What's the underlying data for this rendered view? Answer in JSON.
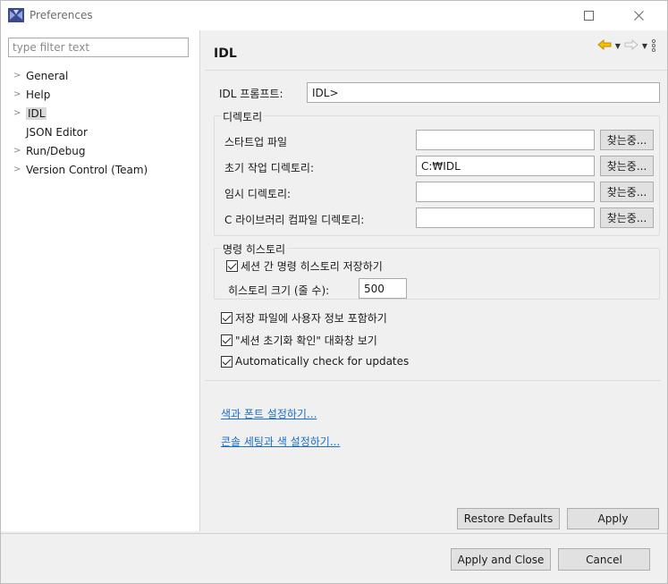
{
  "window": {
    "title": "Preferences",
    "icons": {
      "app": "eclipse-app-icon",
      "maximize": "maximize-icon",
      "close": "close-icon"
    }
  },
  "sidebar": {
    "filter_placeholder": "type filter text",
    "items": [
      {
        "label": "General",
        "expandable": true,
        "selected": false
      },
      {
        "label": "Help",
        "expandable": true,
        "selected": false
      },
      {
        "label": "IDL",
        "expandable": true,
        "selected": true
      },
      {
        "label": "JSON Editor",
        "expandable": false,
        "selected": false
      },
      {
        "label": "Run/Debug",
        "expandable": true,
        "selected": false
      },
      {
        "label": "Version Control (Team)",
        "expandable": true,
        "selected": false
      }
    ]
  },
  "page": {
    "title": "IDL",
    "toolbar_icons": [
      "back-arrow-icon",
      "forward-arrow-icon",
      "view-menu-icon"
    ],
    "prompt": {
      "label": "IDL 프롬프트:",
      "value": "IDL>"
    },
    "directory_group": {
      "title": "디렉토리",
      "rows": [
        {
          "label": "스타트업 파일",
          "value": "",
          "button": "찾는중..."
        },
        {
          "label": "초기 작업 디렉토리:",
          "value": "C:₩IDL",
          "button": "찾는중..."
        },
        {
          "label": "임시 디렉토리:",
          "value": "",
          "button": "찾는중..."
        },
        {
          "label": "C 라이브러리 컴파일 디렉토리:",
          "value": "",
          "button": "찾는중..."
        }
      ]
    },
    "history_group": {
      "title": "명령 히스토리",
      "save_checkbox": {
        "label": "세션 간 명령 히스토리 저장하기",
        "checked": true
      },
      "size": {
        "label": "히스토리 크기 (줄 수):",
        "value": "500"
      }
    },
    "checkboxes": [
      {
        "label": "저장 파일에 사용자 정보 포함하기",
        "checked": true
      },
      {
        "label": "\"세션 초기화 확인\" 대화창 보기",
        "checked": true
      },
      {
        "label": "Automatically check for updates",
        "checked": true
      }
    ],
    "links": [
      {
        "label": "색과 폰트 설정하기..."
      },
      {
        "label": "콘솔 세팅과 색 설정하기..."
      }
    ],
    "restore_defaults": "Restore Defaults",
    "apply": "Apply"
  },
  "footer": {
    "apply_and_close": "Apply and Close",
    "cancel": "Cancel"
  },
  "colors": {
    "link": "#1a6fc9",
    "back_arrow": "#e0a500",
    "selection": "#d9d9d9"
  }
}
